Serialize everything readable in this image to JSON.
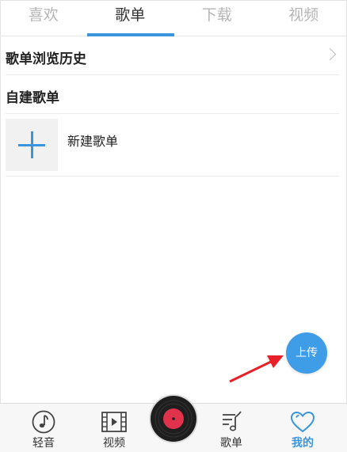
{
  "tabs": [
    {
      "label": "喜欢",
      "active": false
    },
    {
      "label": "歌单",
      "active": true
    },
    {
      "label": "下载",
      "active": false
    },
    {
      "label": "视频",
      "active": false
    }
  ],
  "history": {
    "label": "歌单浏览历史",
    "icon": "chevron-right-icon"
  },
  "section": {
    "title": "自建歌单"
  },
  "new_playlist": {
    "label": "新建歌单",
    "icon": "plus-icon"
  },
  "upload_button": {
    "label": "上传"
  },
  "bottom_nav": {
    "items": [
      {
        "label": "轻音",
        "icon": "music-note-circle-icon"
      },
      {
        "label": "视频",
        "icon": "film-play-icon"
      },
      {
        "label": "歌单",
        "icon": "playlist-note-icon"
      },
      {
        "label": "我的",
        "icon": "heart-icon",
        "active": true
      }
    ],
    "player": {
      "icon": "vinyl-record-icon"
    }
  },
  "colors": {
    "accent": "#3b95dc",
    "upload": "#3f9de8",
    "annotation_arrow": "#e8202a"
  }
}
